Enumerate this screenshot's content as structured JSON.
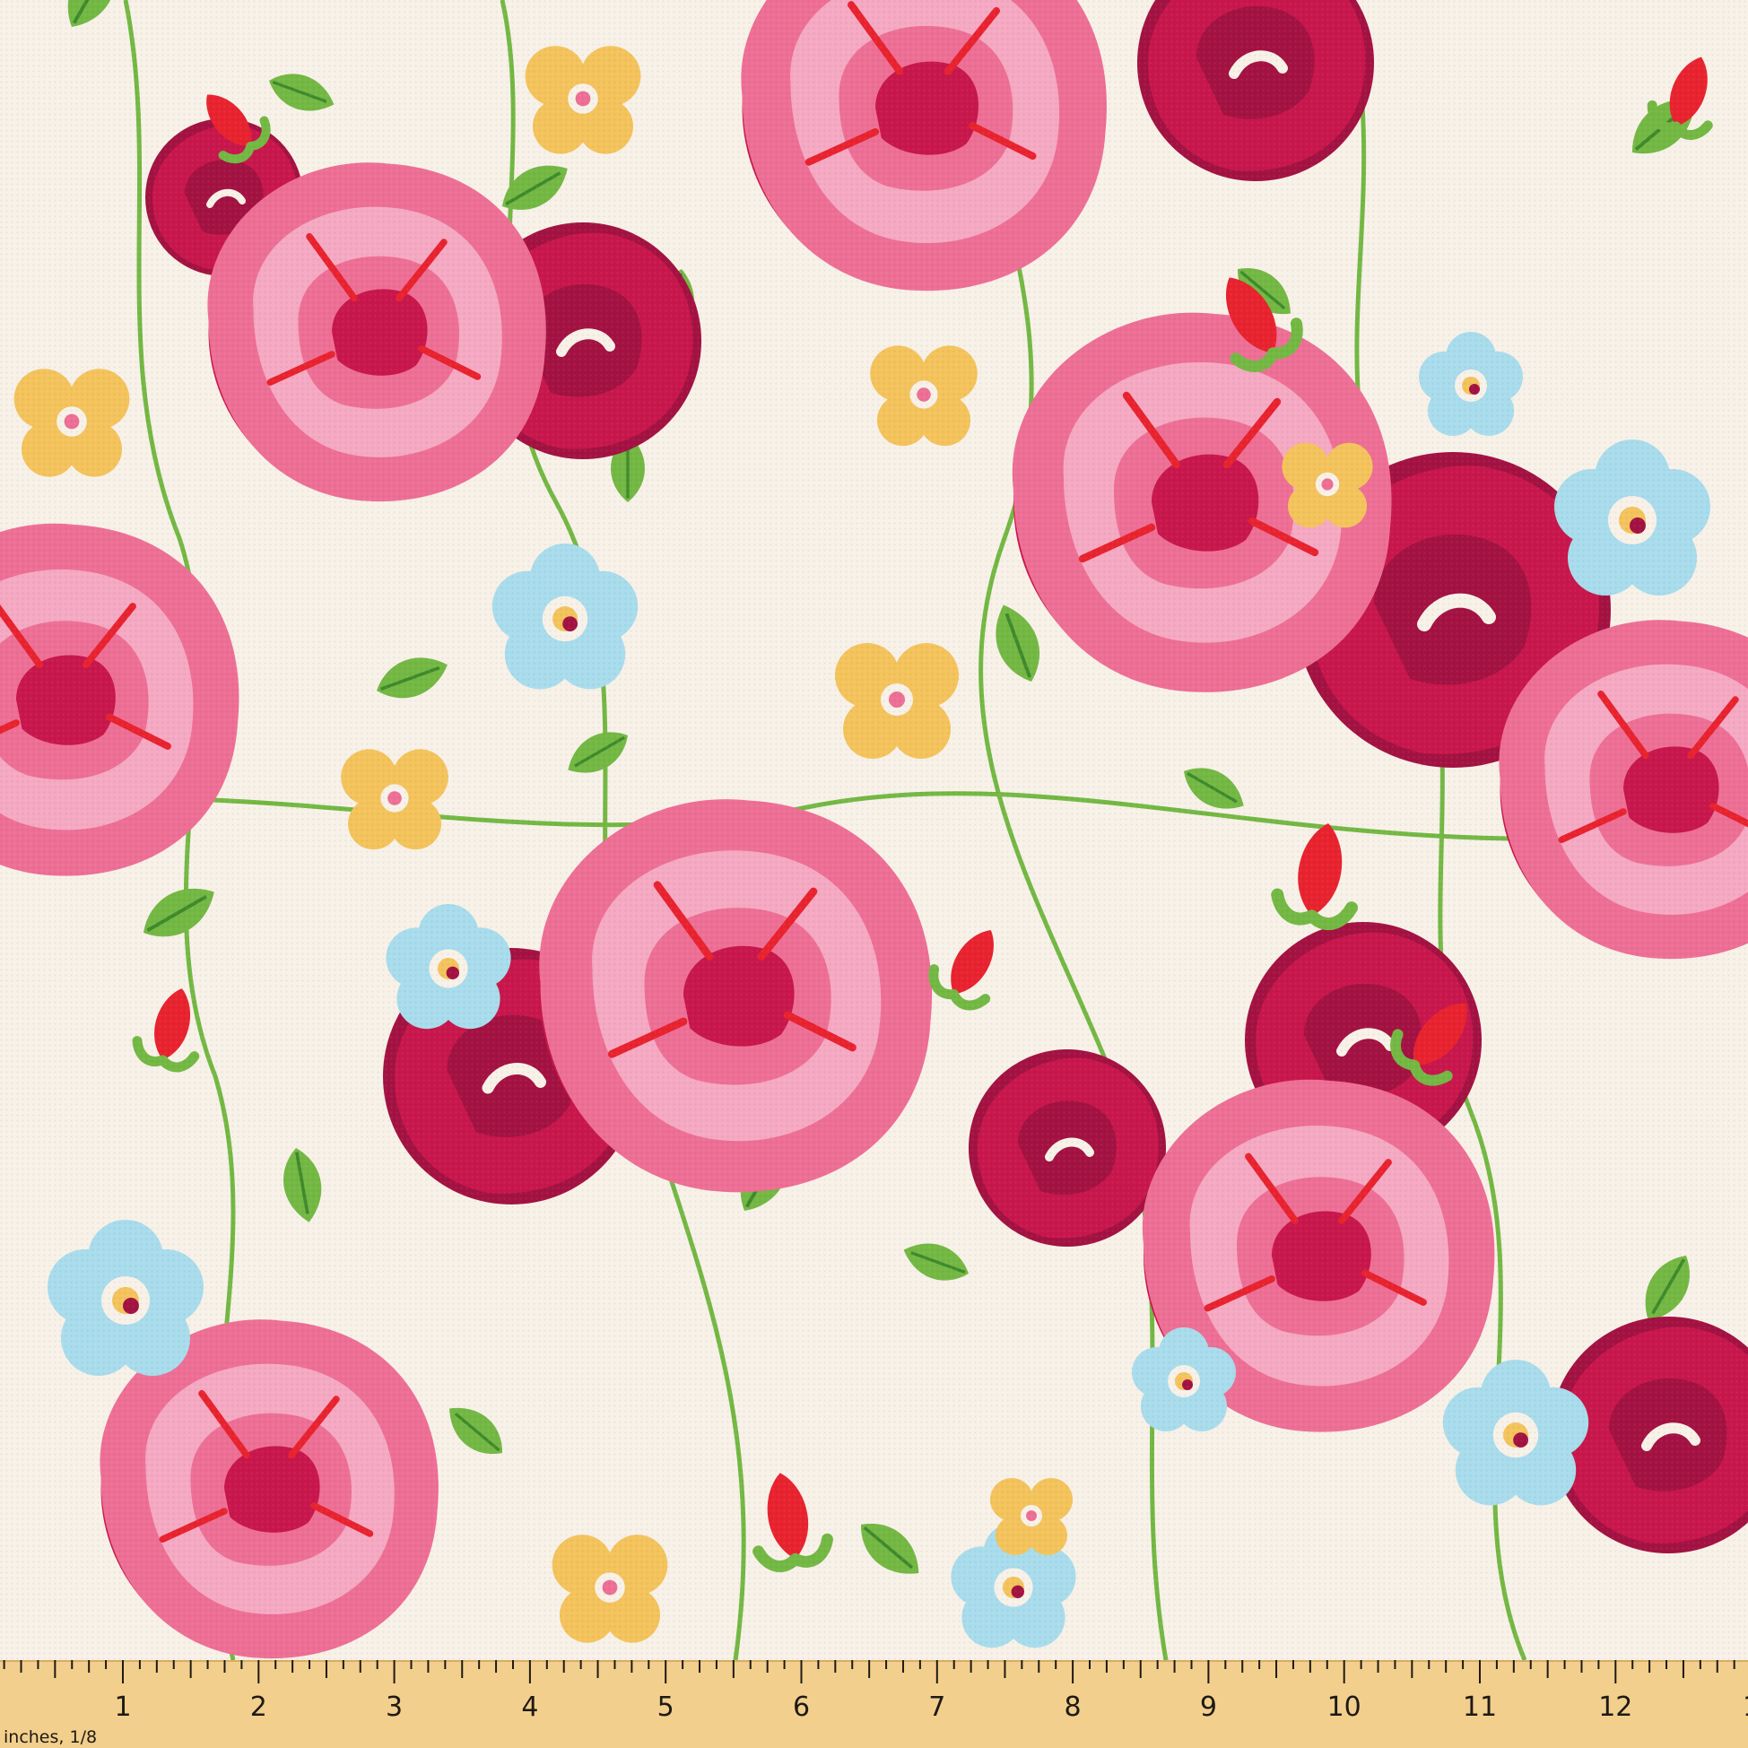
{
  "image": {
    "subject": "floral fabric swatch with a measuring ruler along the bottom edge",
    "motifs": [
      "pink-rose",
      "crimson-rose",
      "blue-forget-me-not",
      "yellow-pansy",
      "red-rosebud",
      "green-leaf"
    ],
    "colors": {
      "background": "#f7f1e8",
      "pink_light": "#f5a9c3",
      "pink": "#ee6f95",
      "crimson": "#c8174c",
      "deep_red": "#a31242",
      "red": "#e8232f",
      "leaf_green": "#74b844",
      "dark_green": "#3f8a2c",
      "sky_blue": "#a9dcec",
      "yellow": "#f4c35c",
      "ruler": "#f2cf8c"
    }
  },
  "ruler": {
    "unit_label": "inches, 1/8",
    "numbers": [
      "1",
      "2",
      "3",
      "4",
      "5",
      "6",
      "7",
      "8",
      "9",
      "10",
      "11",
      "12",
      "1"
    ]
  }
}
